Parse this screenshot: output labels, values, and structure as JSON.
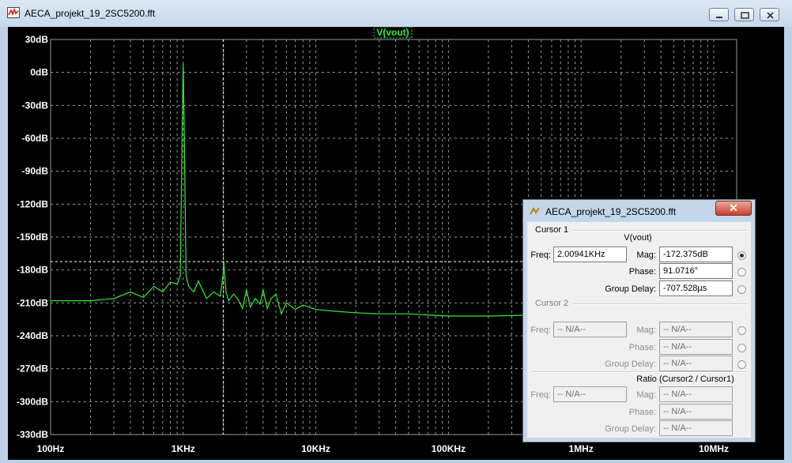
{
  "window": {
    "title": "AECA_projekt_19_2SC5200.fft"
  },
  "plot": {
    "trace_label": "V(vout)",
    "colors": {
      "background": "#000000",
      "grid": "#9a9a9a",
      "trace": "#33ee33",
      "label": "#ffffff",
      "cursor": "#ffffff"
    }
  },
  "chart_data": {
    "type": "line",
    "x_scale": "log",
    "xlim": [
      100,
      15000000
    ],
    "ylim": [
      -330,
      30
    ],
    "xticks": [
      "100Hz",
      "1KHz",
      "10KHz",
      "100KHz",
      "1MHz",
      "10MHz"
    ],
    "yticks": [
      "30dB",
      "0dB",
      "-30dB",
      "-60dB",
      "-90dB",
      "-120dB",
      "-150dB",
      "-180dB",
      "-210dB",
      "-240dB",
      "-270dB",
      "-300dB",
      "-330dB"
    ],
    "grid": true,
    "series": [
      {
        "name": "V(vout)",
        "color": "#33ee33",
        "x": [
          100,
          200,
          300,
          400,
          500,
          600,
          700,
          800,
          900,
          950,
          980,
          1000,
          1020,
          1050,
          1100,
          1200,
          1300,
          1500,
          1700,
          1900,
          2000,
          2020,
          2100,
          2200,
          2400,
          2600,
          2800,
          3000,
          3200,
          3500,
          3800,
          4000,
          4300,
          4600,
          5000,
          5500,
          6000,
          7000,
          8000,
          10000,
          15000,
          20000,
          30000,
          50000,
          70000,
          100000,
          200000,
          500000,
          1000000,
          2000000,
          5000000,
          10000000,
          15000000
        ],
        "y": [
          -208,
          -208,
          -206,
          -200,
          -205,
          -195,
          -200,
          -191,
          -193,
          -185,
          -60,
          8,
          -60,
          -185,
          -195,
          -200,
          -190,
          -206,
          -200,
          -204,
          -185,
          -172,
          -200,
          -208,
          -202,
          -207,
          -215,
          -198,
          -214,
          -206,
          -211,
          -198,
          -215,
          -206,
          -202,
          -220,
          -210,
          -216,
          -212,
          -216,
          -218,
          -219,
          -220,
          -220,
          -221,
          -222,
          -222,
          -221,
          -222,
          -221,
          -221,
          -220,
          -220
        ]
      }
    ],
    "cursor": {
      "freq": 2009.41,
      "mag": -172.375
    }
  },
  "dialog": {
    "title": "AECA_projekt_19_2SC5200.fft",
    "close_label": "✕",
    "cursor1": {
      "group_label": "Cursor 1",
      "signal": "V(vout)",
      "freq_label": "Freq:",
      "freq_value": "2.00941KHz",
      "mag_label": "Mag:",
      "mag_value": "-172.375dB",
      "phase_label": "Phase:",
      "phase_value": "91.0716°",
      "group_delay_label": "Group Delay:",
      "group_delay_value": "-707.528µs"
    },
    "cursor2": {
      "group_label": "Cursor 2",
      "freq_label": "Freq:",
      "freq_value": "-- N/A--",
      "mag_label": "Mag:",
      "mag_value": "-- N/A--",
      "phase_label": "Phase:",
      "phase_value": "-- N/A--",
      "group_delay_label": "Group Delay:",
      "group_delay_value": "-- N/A--"
    },
    "ratio": {
      "group_label": "Ratio (Cursor2 / Cursor1)",
      "freq_label": "Freq:",
      "freq_value": "-- N/A--",
      "mag_label": "Mag:",
      "mag_value": "-- N/A--",
      "phase_label": "Phase:",
      "phase_value": "-- N/A--",
      "group_delay_label": "Group Delay:",
      "group_delay_value": "-- N/A--"
    }
  }
}
